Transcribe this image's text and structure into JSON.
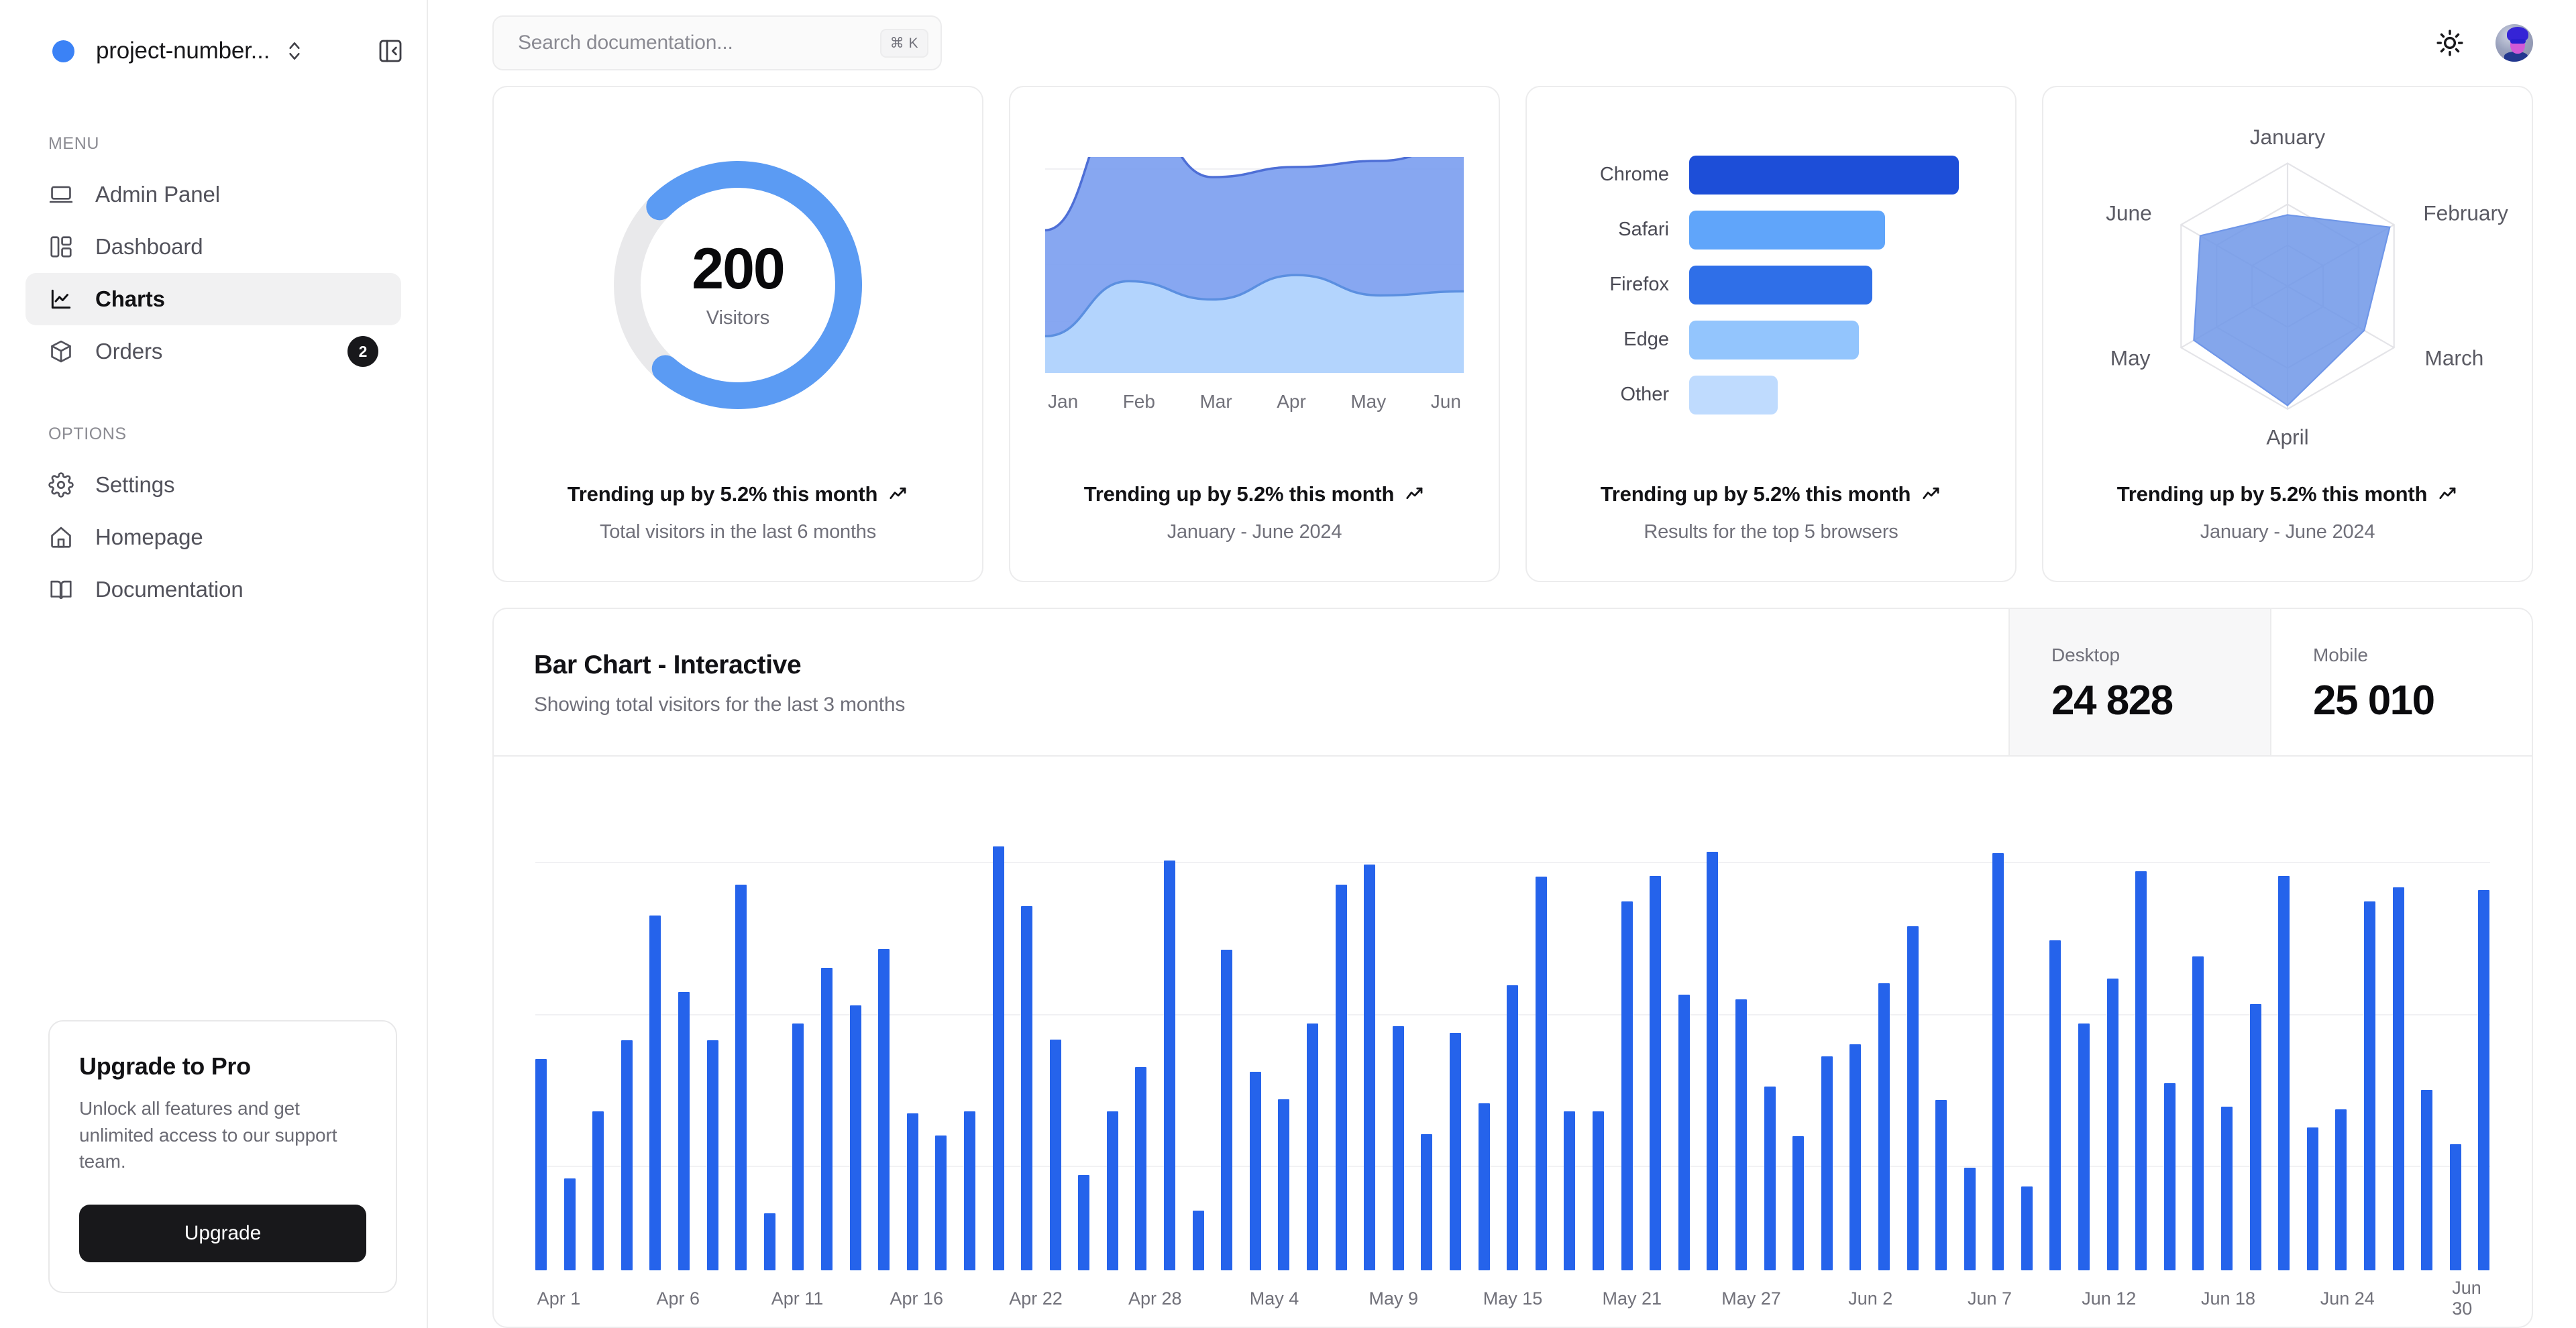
{
  "sidebar": {
    "project": {
      "name": "project-number...",
      "dot_color": "#3b82f6"
    },
    "menu_label": "MENU",
    "menu_items": [
      {
        "label": "Admin Panel",
        "icon": "laptop-icon",
        "badge": null,
        "active": false
      },
      {
        "label": "Dashboard",
        "icon": "layout-dashboard-icon",
        "badge": null,
        "active": false
      },
      {
        "label": "Charts",
        "icon": "line-chart-icon",
        "badge": null,
        "active": true
      },
      {
        "label": "Orders",
        "icon": "package-icon",
        "badge": "2",
        "active": false
      }
    ],
    "options_label": "OPTIONS",
    "options_items": [
      {
        "label": "Settings",
        "icon": "gear-icon"
      },
      {
        "label": "Homepage",
        "icon": "home-icon"
      },
      {
        "label": "Documentation",
        "icon": "book-open-icon"
      }
    ],
    "upgrade": {
      "title": "Upgrade to Pro",
      "description": "Unlock all features and get unlimited access to our support team.",
      "button_label": "Upgrade"
    }
  },
  "topbar": {
    "search_placeholder": "Search documentation...",
    "search_value": "",
    "shortcut": "⌘ K",
    "theme_icon": "sun-icon",
    "avatar": "user-avatar"
  },
  "cards": {
    "radial": {
      "footer_main": "Trending up by 5.2% this month",
      "footer_sub": "Total visitors in the last 6 months"
    },
    "area": {
      "footer_main": "Trending up by 5.2% this month",
      "footer_sub": "January - June 2024"
    },
    "browsers": {
      "footer_main": "Trending up by 5.2% this month",
      "footer_sub": "Results for the top 5 browsers"
    },
    "radar": {
      "footer_main": "Trending up by 5.2% this month",
      "footer_sub": "January - June 2024"
    }
  },
  "bar_card": {
    "title": "Bar Chart - Interactive",
    "subtitle": "Showing total visitors for the last 3 months",
    "stats": [
      {
        "label": "Desktop",
        "value": "24 828",
        "active": true
      },
      {
        "label": "Mobile",
        "value": "25 010",
        "active": false
      }
    ]
  },
  "chart_data": [
    {
      "id": "radial-visitors",
      "type": "pie",
      "variant": "radial-gauge",
      "title": "",
      "center_value": "200",
      "center_label": "Visitors",
      "value": 200,
      "max": 270,
      "percent_of_circle": 74,
      "track_color": "#e9e9eb",
      "arc_color": "#5b9bf3",
      "start_angle_deg": 225,
      "sweep_deg": 266
    },
    {
      "id": "area-visitors",
      "type": "area",
      "stacked": true,
      "title": "",
      "xlabel": "",
      "ylabel": "",
      "categories": [
        "Jan",
        "Feb",
        "Mar",
        "Apr",
        "May",
        "Jun"
      ],
      "tick_labels": [
        "Jan",
        "Feb",
        "Mar",
        "Apr",
        "May",
        "Jun"
      ],
      "grid": true,
      "ylim": [
        0,
        100
      ],
      "series": [
        {
          "name": "lower",
          "color": "#b3d4fd",
          "values": [
            18,
            45,
            36,
            48,
            38,
            40
          ]
        },
        {
          "name": "upper",
          "color": "#7d9ff0",
          "values": [
            52,
            90,
            60,
            53,
            66,
            73
          ]
        }
      ]
    },
    {
      "id": "browsers-bar",
      "type": "bar",
      "orientation": "horizontal",
      "title": "",
      "categories": [
        "Chrome",
        "Safari",
        "Firefox",
        "Edge",
        "Other"
      ],
      "values": [
        275,
        200,
        187,
        173,
        90
      ],
      "max": 290,
      "colors": [
        "#1d4ed8",
        "#60a5fa",
        "#2f6fe8",
        "#93c5fd",
        "#bfdbfe"
      ],
      "xlabel": "",
      "ylabel": ""
    },
    {
      "id": "radar-months",
      "type": "line",
      "variant": "radar",
      "title": "",
      "categories": [
        "January",
        "February",
        "March",
        "April",
        "May",
        "June"
      ],
      "values": [
        58,
        96,
        72,
        97,
        88,
        82
      ],
      "max": 100,
      "fill_color": "#6f96e8",
      "fill_opacity": 0.85,
      "grid_rings": 3,
      "grid": true
    },
    {
      "id": "interactive-visitors-bar",
      "type": "bar",
      "orientation": "vertical",
      "title": "Bar Chart - Interactive",
      "subtitle": "Showing total visitors for the last 3 months",
      "xlabel": "",
      "ylabel": "",
      "series_name": "Desktop",
      "bar_color": "#2563eb",
      "grid": true,
      "ylim": [
        0,
        500
      ],
      "tick_labels": [
        "Apr 1",
        "Apr 6",
        "Apr 11",
        "Apr 16",
        "Apr 22",
        "Apr 28",
        "May 4",
        "May 9",
        "May 15",
        "May 21",
        "May 27",
        "Jun 2",
        "Jun 7",
        "Jun 12",
        "Jun 18",
        "Jun 24",
        "Jun 30"
      ],
      "values": [
        222,
        97,
        167,
        242,
        373,
        293,
        242,
        406,
        60,
        260,
        318,
        279,
        338,
        165,
        142,
        167,
        446,
        383,
        243,
        100,
        167,
        214,
        431,
        63,
        337,
        209,
        180,
        260,
        406,
        427,
        257,
        143,
        250,
        176,
        300,
        414,
        167,
        167,
        388,
        415,
        290,
        440,
        285,
        193,
        141,
        225,
        238,
        302,
        362,
        179,
        108,
        439,
        88,
        347,
        260,
        307,
        420,
        197,
        330,
        172,
        280,
        415,
        150,
        169,
        388,
        403,
        190,
        133,
        400
      ]
    }
  ]
}
